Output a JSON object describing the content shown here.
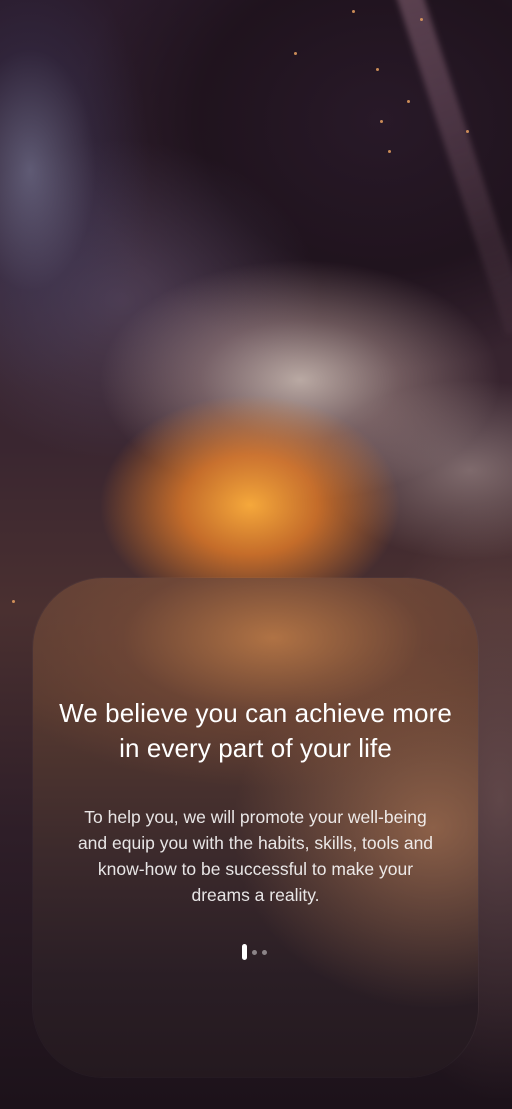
{
  "onboarding": {
    "headline": "We believe you can achieve more in every part of your life",
    "body": "To help you, we will promote your well-being and equip you with the habits, skills, tools and know-how to be successful to make your dreams a reality.",
    "pager": {
      "total_pages": 3,
      "current_page": 1
    }
  },
  "colors": {
    "text": "#ffffff",
    "accent_orange": "#f0a040",
    "card_top": "#5e3f37",
    "card_bottom": "#24191f"
  }
}
